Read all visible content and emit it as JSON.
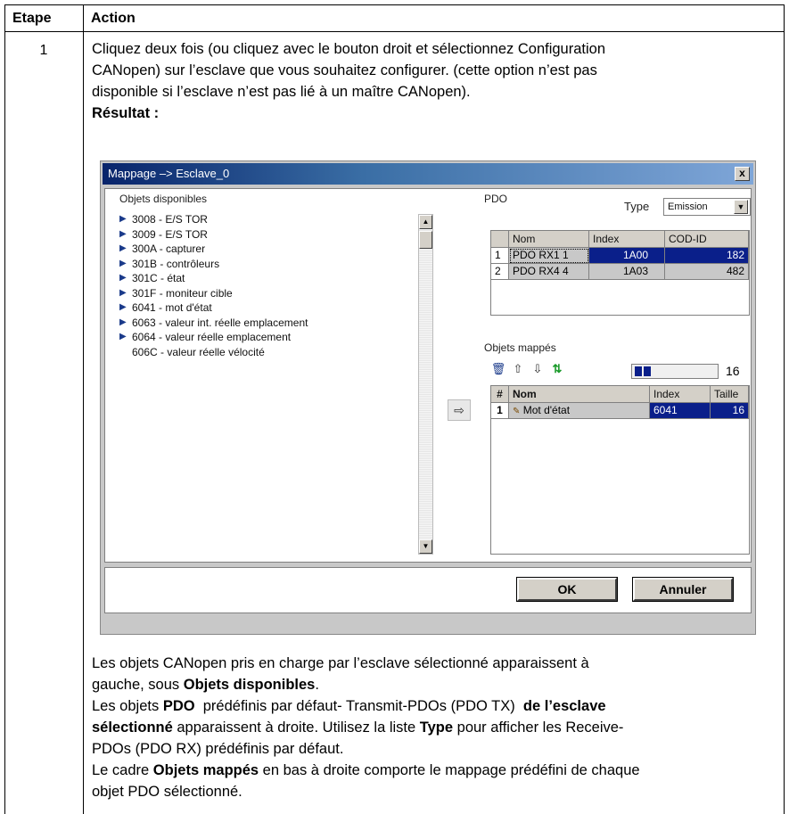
{
  "table": {
    "col_step": "Etape",
    "col_action": "Action",
    "step_number": "1"
  },
  "intro": {
    "line1": "Cliquez deux fois (ou cliquez avec le bouton droit et sélectionnez Configuration",
    "line2": "CANopen) sur l’esclave que vous souhaitez configurer. (cette option n’est pas",
    "line3": "disponible si l’esclave n’est pas lié à un maître CANopen).",
    "result_label": "Résultat :"
  },
  "dialog": {
    "title": "Mappage  –>  Esclave_0",
    "close": "x",
    "available_label": "Objets disponibles",
    "available_objects": [
      {
        "code": "3008",
        "desc": "- E/S TOR",
        "expandable": true
      },
      {
        "code": "3009",
        "desc": "- E/S TOR",
        "expandable": true
      },
      {
        "code": "300A",
        "desc": "- capturer",
        "expandable": true
      },
      {
        "code": "301B",
        "desc": "- contrôleurs",
        "expandable": true
      },
      {
        "code": "301C",
        "desc": "- état",
        "expandable": true
      },
      {
        "code": "301F",
        "desc": "- moniteur cible",
        "expandable": true
      },
      {
        "code": "6041",
        "desc": "- mot d'état",
        "expandable": true
      },
      {
        "code": "6063",
        "desc": "- valeur int. réelle emplacement",
        "expandable": true
      },
      {
        "code": "6064",
        "desc": "- valeur réelle emplacement",
        "expandable": true
      },
      {
        "code": "606C",
        "desc": "- valeur réelle vélocité",
        "expandable": false
      }
    ],
    "pdo_label": "PDO",
    "type_label": "Type",
    "type_value": "Emission",
    "pdo_columns": [
      "Nom",
      "Index",
      "COD-ID"
    ],
    "pdo_rows": [
      {
        "num": "1",
        "nom": "PDO RX1 1",
        "index": "1A00",
        "cod": "182"
      },
      {
        "num": "2",
        "nom": "PDO RX4 4",
        "index": "1A03",
        "cod": "482"
      }
    ],
    "mapped_label": "Objets mappés",
    "mapped_fill": 0.2,
    "mapped_count": "16",
    "mapped_columns": [
      "#",
      "Nom",
      "Index",
      "Taille"
    ],
    "mapped_rows": [
      {
        "num": "1",
        "nom": "Mot d'état",
        "index": "6041",
        "taille": "16"
      }
    ],
    "ok_label": "OK",
    "cancel_label": "Annuler"
  },
  "after": {
    "p1a": "Les objets CANopen pris en charge par l’esclave sélectionné apparaissent à",
    "p1b": "gauche, sous ",
    "p1b_bold": "Objets disponibles",
    "p1b_end": ".",
    "p2a": "Les objets ",
    "p2a_bold1": "PDO",
    "p2a_mid": "  prédéfinis par défaut- Transmit-PDOs (PDO TX)  ",
    "p2a_bold2": "de l’esclave",
    "p2b_bold": "sélectionné",
    "p2b_mid": " apparaissent à droite. Utilisez la liste ",
    "p2b_bold2": "Type",
    "p2b_end": " pour afficher les Receive-",
    "p2c": "PDOs (PDO RX) prédéfinis par défaut.",
    "p3a": "Le cadre ",
    "p3a_bold": "Objets mappés",
    "p3a_end": " en bas à droite comporte le mappage prédéfini de chaque",
    "p3b": "objet PDO sélectionné."
  }
}
